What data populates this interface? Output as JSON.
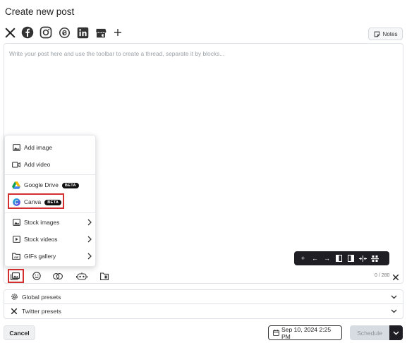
{
  "page": {
    "title": "Create new post"
  },
  "networks": [
    {
      "name": "x-icon"
    },
    {
      "name": "facebook-icon"
    },
    {
      "name": "instagram-icon"
    },
    {
      "name": "threads-icon"
    },
    {
      "name": "linkedin-icon"
    },
    {
      "name": "google-business-icon"
    },
    {
      "name": "add-network-icon"
    }
  ],
  "notes": {
    "label": "Notes"
  },
  "editor": {
    "placeholder": "Write your post here and use the toolbar to create a thread, separate it by blocks...",
    "char_count": "0 / 280"
  },
  "media_menu": {
    "add_image": "Add image",
    "add_video": "Add video",
    "google_drive": "Google Drive",
    "google_drive_badge": "BETA",
    "canva": "Canva",
    "canva_badge": "BETA",
    "stock_images": "Stock images",
    "stock_videos": "Stock videos",
    "gifs_gallery": "GIFs gallery"
  },
  "floating_toolbar": [
    "+",
    "←",
    "→"
  ],
  "presets": {
    "global": "Global presets",
    "twitter": "Twitter presets"
  },
  "footer": {
    "cancel": "Cancel",
    "date": "Sep 10, 2024 2:25 PM",
    "schedule": "Schedule"
  },
  "colors": {
    "highlight": "#d32f2f",
    "dark": "#1e1e24",
    "disabled_bg": "#d7dce2"
  }
}
